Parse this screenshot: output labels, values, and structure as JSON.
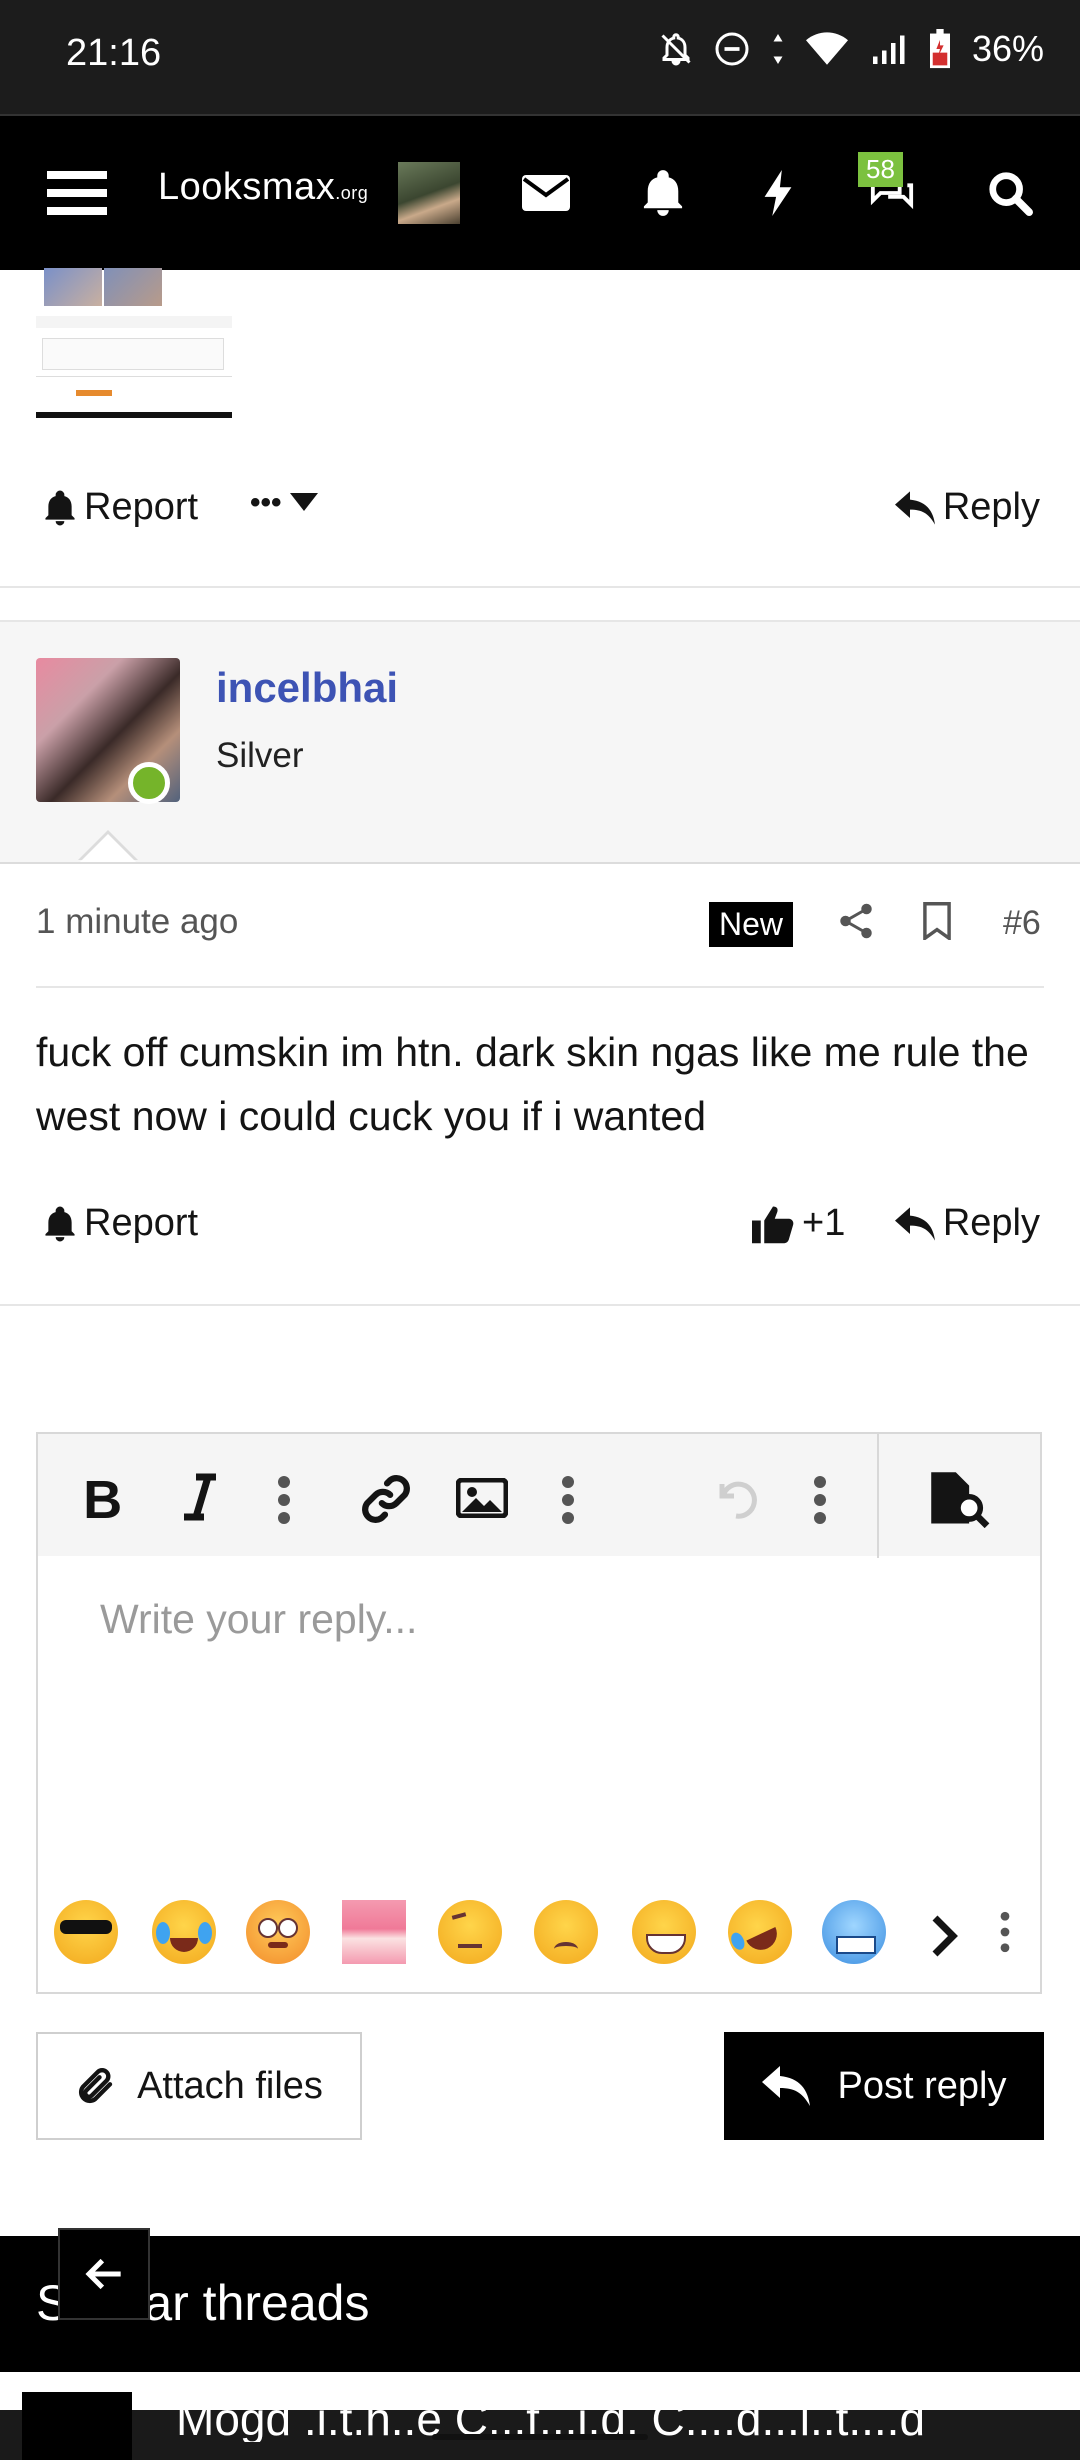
{
  "status_bar": {
    "time": "21:16",
    "battery": "36%",
    "icons": [
      "bell-off-icon",
      "dnd-icon",
      "data-arrows-icon",
      "wifi-icon",
      "signal-icon",
      "battery-icon"
    ]
  },
  "header": {
    "logo_main": "Looksmax",
    "logo_suffix": ".org",
    "alerts_badge": "58",
    "icons": [
      "menu-icon",
      "avatar-icon",
      "mail-icon",
      "bell-icon",
      "lightning-icon",
      "chat-icon",
      "search-icon"
    ]
  },
  "previous_post": {
    "report_label": "Report",
    "more_label": "•••",
    "reply_label": "Reply"
  },
  "post": {
    "username": "incelbhai",
    "user_title": "Silver",
    "time": "1 minute ago",
    "new_label": "New",
    "number": "#6",
    "body": "fuck off cumskin im htn. dark skin ngas like me rule the west now i could cuck you if i wanted",
    "report_label": "Report",
    "reaction_count": "+1",
    "reply_label": "Reply"
  },
  "editor": {
    "placeholder": "Write your reply...",
    "toolbar": [
      "bold-icon",
      "italic-icon",
      "more-vertical-icon",
      "link-icon",
      "image-icon",
      "more-vertical-icon",
      "undo-icon",
      "more-vertical-icon",
      "preview-icon"
    ],
    "emojis": [
      "sunglasses",
      "tears-of-joy",
      "flushed",
      "anime-girl",
      "raised-eyebrow",
      "worried",
      "grin-sweat",
      "rofl",
      "cold-face"
    ]
  },
  "buttons": {
    "attach_label": "Attach files",
    "post_reply_label": "Post reply"
  },
  "similar": {
    "title": "Similar threads",
    "next_thread_text": "Mogd .i.t.h..e C...f...i.d. C....d...l..t....d"
  },
  "colors": {
    "username": "#3d53b4",
    "online": "#75b42a",
    "badge": "#7cc13f"
  }
}
